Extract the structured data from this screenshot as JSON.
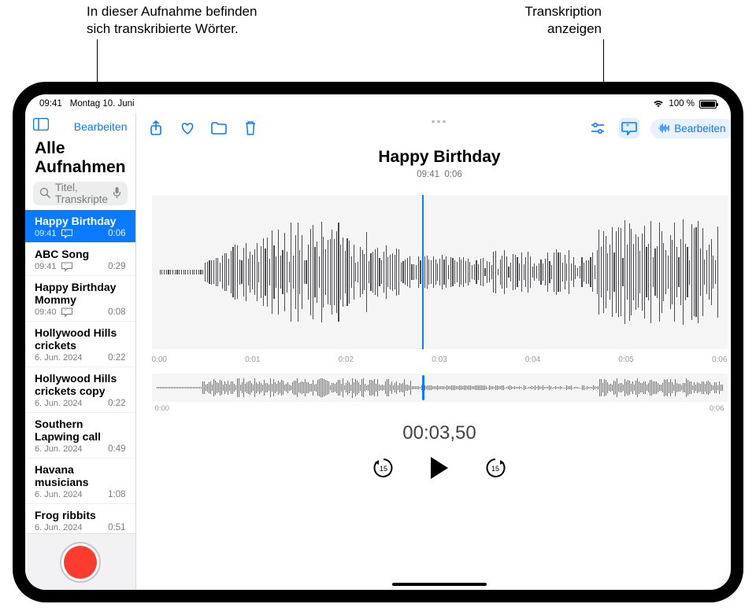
{
  "callouts": {
    "left": "In dieser Aufnahme befinden sich transkribierte Wörter.",
    "right": "Transkription anzeigen"
  },
  "status": {
    "time": "09:41",
    "date": "Montag 10. Juni",
    "battery": "100 %"
  },
  "sidebar": {
    "edit": "Bearbeiten",
    "title": "Alle Aufnahmen",
    "search_placeholder": "Titel, Transkripte",
    "items": [
      {
        "title": "Happy Birthday",
        "meta": "09:41",
        "duration": "0:06",
        "has_transcript": true,
        "selected": true
      },
      {
        "title": "ABC Song",
        "meta": "09:41",
        "duration": "0:29",
        "has_transcript": true
      },
      {
        "title": "Happy Birthday Mommy",
        "meta": "09:40",
        "duration": "0:08",
        "has_transcript": true
      },
      {
        "title": "Hollywood Hills crickets",
        "meta": "6. Jun. 2024",
        "duration": "0:22"
      },
      {
        "title": "Hollywood Hills crickets copy",
        "meta": "6. Jun. 2024",
        "duration": "0:22"
      },
      {
        "title": "Southern Lapwing call",
        "meta": "6. Jun. 2024",
        "duration": "0:49"
      },
      {
        "title": "Havana musicians",
        "meta": "6. Jun. 2024",
        "duration": "1:08"
      },
      {
        "title": "Frog ribbits",
        "meta": "6. Jun. 2024",
        "duration": "0:51"
      }
    ]
  },
  "main": {
    "title": "Happy Birthday",
    "subtitle_time": "09:41",
    "subtitle_dur": "0:06",
    "ticks": [
      "0:00",
      "0:01",
      "0:02",
      "0:03",
      "0:04",
      "0:05",
      "0:06"
    ],
    "overview_start": "0:00",
    "overview_end": "0:06",
    "current_time": "00:03,50",
    "skip_back": "15",
    "skip_fwd": "15",
    "edit_button": "Bearbeiten"
  }
}
